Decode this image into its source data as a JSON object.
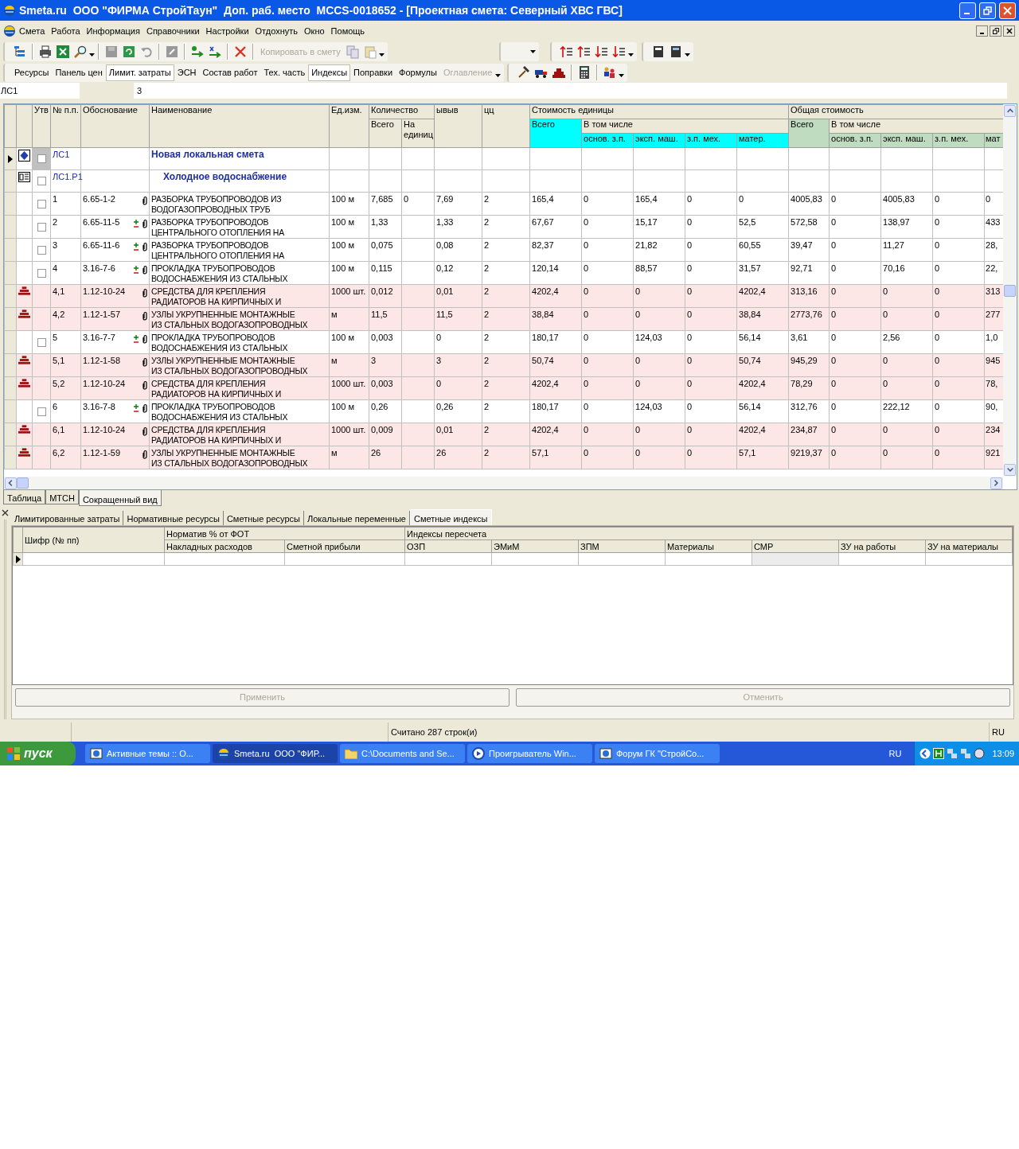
{
  "window": {
    "title": "Smeta.ru  ООО \"ФИРМА СтройТаун\"  Доп. раб. место  MCCS-0018652 - [Проектная смета: Северный ХВС ГВС]"
  },
  "menu": [
    "Смета",
    "Работа",
    "Информация",
    "Справочники",
    "Настройки",
    "Отдохнуть",
    "Окно",
    "Помощь"
  ],
  "copy_button": {
    "label": "Копировать в смету",
    "disabled": true
  },
  "view_buttons": [
    {
      "label": "Ресурсы",
      "pressed": false,
      "disabled": false
    },
    {
      "label": "Панель цен",
      "pressed": false,
      "disabled": false
    },
    {
      "label": "Лимит. затраты",
      "pressed": true,
      "disabled": false
    },
    {
      "label": "ЭСН",
      "pressed": false,
      "disabled": false
    },
    {
      "label": "Состав работ",
      "pressed": false,
      "disabled": false
    },
    {
      "label": "Тех. часть",
      "pressed": false,
      "disabled": false
    },
    {
      "label": "Индексы",
      "pressed": true,
      "disabled": false
    },
    {
      "label": "Поправки",
      "pressed": false,
      "disabled": false
    },
    {
      "label": "Формулы",
      "pressed": false,
      "disabled": false
    },
    {
      "label": "Оглавление",
      "pressed": false,
      "disabled": true
    }
  ],
  "cell_bar": {
    "address": "ЛС1",
    "value": "3"
  },
  "table": {
    "fixed_columns": [
      "Утв",
      "№ п.п.",
      "Обоснование",
      "Наименование",
      "Ед.изм."
    ],
    "quantity": {
      "label": "Количество",
      "sub": [
        "Всего",
        "На единиц"
      ]
    },
    "extra_columns": [
      "ывыв",
      "цц"
    ],
    "cost_groups": [
      {
        "label": "Стоимость единицы",
        "total": "Всего",
        "subgroup": "В том числе",
        "sub": [
          "основ. з.п.",
          "эксп. маш.",
          "з.п. мех.",
          "матер."
        ],
        "color": "#00ffff"
      },
      {
        "label": "Общая стоимость",
        "total": "Всего",
        "subgroup": "В том числе",
        "sub": [
          "основ. з.п.",
          "эксп. маш.",
          "з.п. мех.",
          "мат"
        ],
        "color": "#c0dcc0"
      }
    ],
    "rows": [
      {
        "kind": "estimate",
        "current": true,
        "checked": false,
        "num": "ЛС1",
        "name": "Новая локальная смета"
      },
      {
        "kind": "section",
        "current": false,
        "checked": false,
        "num": "ЛС1.Р1",
        "name": "Холодное водоснабжение"
      },
      {
        "kind": "work",
        "current": false,
        "checked": false,
        "num": "1",
        "code": "6.65-1-2",
        "plus": false,
        "clip": true,
        "name": "РАЗБОРКА ТРУБОПРОВОДОВ ИЗ\nВОДОГАЗОПРОВОДНЫХ ТРУБ",
        "unit": "100 м",
        "qty_total": "7,685",
        "qty_per_unit": "0",
        "col_9": "7,69",
        "col_10": "2",
        "unit_cost": [
          "165,4",
          "0",
          "165,4",
          "0",
          "0"
        ],
        "total_cost": [
          "4005,83",
          "0",
          "4005,83",
          "0",
          "0"
        ]
      },
      {
        "kind": "work",
        "current": false,
        "checked": false,
        "num": "2",
        "code": "6.65-11-5",
        "plus": true,
        "clip": true,
        "name": "РАЗБОРКА ТРУБОПРОВОДОВ\nЦЕНТРАЛЬНОГО ОТОПЛЕНИЯ НА",
        "unit": "100 м",
        "qty_total": "1,33",
        "col_9": "1,33",
        "col_10": "2",
        "unit_cost": [
          "67,67",
          "0",
          "15,17",
          "0",
          "52,5"
        ],
        "total_cost": [
          "572,58",
          "0",
          "138,97",
          "0",
          "433"
        ]
      },
      {
        "kind": "work",
        "current": false,
        "checked": false,
        "num": "3",
        "code": "6.65-11-6",
        "plus": true,
        "clip": true,
        "name": "РАЗБОРКА ТРУБОПРОВОДОВ\nЦЕНТРАЛЬНОГО ОТОПЛЕНИЯ НА",
        "unit": "100 м",
        "qty_total": "0,075",
        "col_9": "0,08",
        "col_10": "2",
        "unit_cost": [
          "82,37",
          "0",
          "21,82",
          "0",
          "60,55"
        ],
        "total_cost": [
          "39,47",
          "0",
          "11,27",
          "0",
          "28,"
        ]
      },
      {
        "kind": "work",
        "current": false,
        "checked": false,
        "num": "4",
        "code": "3.16-7-6",
        "plus": true,
        "clip": true,
        "name": "ПРОКЛАДКА ТРУБОПРОВОДОВ\nВОДОСНАБЖЕНИЯ ИЗ СТАЛЬНЫХ",
        "unit": "100 м",
        "qty_total": "0,115",
        "col_9": "0,12",
        "col_10": "2",
        "unit_cost": [
          "120,14",
          "0",
          "88,57",
          "0",
          "31,57"
        ],
        "total_cost": [
          "92,71",
          "0",
          "70,16",
          "0",
          "22,"
        ]
      },
      {
        "kind": "material",
        "current": false,
        "num": "4,1",
        "code": "1.12-10-24",
        "plus": false,
        "clip": true,
        "name": "СРЕДСТВА ДЛЯ КРЕПЛЕНИЯ\nРАДИАТОРОВ НА КИРПИЧНЫХ И",
        "unit": "1000 шт.",
        "qty_total": "0,012",
        "col_9": "0,01",
        "col_10": "2",
        "unit_cost": [
          "4202,4",
          "0",
          "0",
          "0",
          "4202,4"
        ],
        "total_cost": [
          "313,16",
          "0",
          "0",
          "0",
          "313"
        ]
      },
      {
        "kind": "material",
        "current": false,
        "num": "4,2",
        "code": "1.12-1-57",
        "plus": false,
        "clip": true,
        "name": "УЗЛЫ УКРУПНЕННЫЕ МОНТАЖНЫЕ\nИЗ СТАЛЬНЫХ ВОДОГАЗОПРОВОДНЫХ",
        "unit": "м",
        "qty_total": "11,5",
        "col_9": "11,5",
        "col_10": "2",
        "unit_cost": [
          "38,84",
          "0",
          "0",
          "0",
          "38,84"
        ],
        "total_cost": [
          "2773,76",
          "0",
          "0",
          "0",
          "277"
        ]
      },
      {
        "kind": "work",
        "current": false,
        "checked": false,
        "num": "5",
        "code": "3.16-7-7",
        "plus": true,
        "clip": true,
        "name": "ПРОКЛАДКА ТРУБОПРОВОДОВ\nВОДОСНАБЖЕНИЯ ИЗ СТАЛЬНЫХ",
        "unit": "100 м",
        "qty_total": "0,003",
        "col_9": "0",
        "col_10": "2",
        "unit_cost": [
          "180,17",
          "0",
          "124,03",
          "0",
          "56,14"
        ],
        "total_cost": [
          "3,61",
          "0",
          "2,56",
          "0",
          "1,0"
        ]
      },
      {
        "kind": "material",
        "current": false,
        "num": "5,1",
        "code": "1.12-1-58",
        "plus": false,
        "clip": true,
        "name": "УЗЛЫ УКРУПНЕННЫЕ МОНТАЖНЫЕ\nИЗ СТАЛЬНЫХ ВОДОГАЗОПРОВОДНЫХ",
        "unit": "м",
        "qty_total": "3",
        "col_9": "3",
        "col_10": "2",
        "unit_cost": [
          "50,74",
          "0",
          "0",
          "0",
          "50,74"
        ],
        "total_cost": [
          "945,29",
          "0",
          "0",
          "0",
          "945"
        ]
      },
      {
        "kind": "material",
        "current": false,
        "num": "5,2",
        "code": "1.12-10-24",
        "plus": false,
        "clip": true,
        "name": "СРЕДСТВА ДЛЯ КРЕПЛЕНИЯ\nРАДИАТОРОВ НА КИРПИЧНЫХ И",
        "unit": "1000 шт.",
        "qty_total": "0,003",
        "col_9": "0",
        "col_10": "2",
        "unit_cost": [
          "4202,4",
          "0",
          "0",
          "0",
          "4202,4"
        ],
        "total_cost": [
          "78,29",
          "0",
          "0",
          "0",
          "78,"
        ]
      },
      {
        "kind": "work",
        "current": false,
        "checked": false,
        "num": "6",
        "code": "3.16-7-8",
        "plus": true,
        "clip": true,
        "name": "ПРОКЛАДКА ТРУБОПРОВОДОВ\nВОДОСНАБЖЕНИЯ ИЗ СТАЛЬНЫХ",
        "unit": "100 м",
        "qty_total": "0,26",
        "col_9": "0,26",
        "col_10": "2",
        "unit_cost": [
          "180,17",
          "0",
          "124,03",
          "0",
          "56,14"
        ],
        "total_cost": [
          "312,76",
          "0",
          "222,12",
          "0",
          "90,"
        ]
      },
      {
        "kind": "material",
        "current": false,
        "num": "6,1",
        "code": "1.12-10-24",
        "plus": false,
        "clip": true,
        "name": "СРЕДСТВА ДЛЯ КРЕПЛЕНИЯ\nРАДИАТОРОВ НА КИРПИЧНЫХ И",
        "unit": "1000 шт.",
        "qty_total": "0,009",
        "col_9": "0,01",
        "col_10": "2",
        "unit_cost": [
          "4202,4",
          "0",
          "0",
          "0",
          "4202,4"
        ],
        "total_cost": [
          "234,87",
          "0",
          "0",
          "0",
          "234"
        ]
      },
      {
        "kind": "material",
        "current": false,
        "num": "6,2",
        "code": "1.12-1-59",
        "plus": false,
        "clip": true,
        "name": "УЗЛЫ УКРУПНЕННЫЕ МОНТАЖНЫЕ\nИЗ СТАЛЬНЫХ ВОДОГАЗОПРОВОДНЫХ",
        "unit": "м",
        "qty_total": "26",
        "col_9": "26",
        "col_10": "2",
        "unit_cost": [
          "57,1",
          "0",
          "0",
          "0",
          "57,1"
        ],
        "total_cost": [
          "9219,37",
          "0",
          "0",
          "0",
          "921"
        ]
      }
    ]
  },
  "sheet_tabs": [
    {
      "label": "Таблица",
      "selected": false
    },
    {
      "label": "МТСН",
      "selected": false
    },
    {
      "label": "Сокращенный вид",
      "selected": true
    }
  ],
  "panel_tabs": [
    {
      "label": "Лимитированные затраты",
      "selected": false
    },
    {
      "label": "Нормативные ресурсы",
      "selected": false
    },
    {
      "label": "Сметные ресурсы",
      "selected": false
    },
    {
      "label": "Локальные переменные",
      "selected": false
    },
    {
      "label": "Сметные индексы",
      "selected": true
    }
  ],
  "index_grid": {
    "key_column": "Шифр (№ пп)",
    "groups": [
      {
        "label": "Норматив % от ФОТ",
        "columns": [
          "Накладных расходов",
          "Сметной прибыли"
        ]
      },
      {
        "label": "Индексы пересчета",
        "columns": [
          "ОЗП",
          "ЭМиМ",
          "ЗПМ",
          "Материалы",
          "СМР",
          "ЗУ на работы",
          "ЗУ на материалы"
        ]
      }
    ]
  },
  "panel_buttons": [
    {
      "label": "Применить",
      "disabled": true
    },
    {
      "label": "Отменить",
      "disabled": true
    }
  ],
  "status_bar": {
    "message": "Считано 287 строк(и)",
    "language": "RU"
  },
  "taskbar": {
    "start": "пуск",
    "tasks": [
      {
        "label": "Активные темы :: О...",
        "kind": "browser",
        "selected": false
      },
      {
        "label": "Smeta.ru  ООО \"ФИР...",
        "kind": "app",
        "selected": true
      },
      {
        "label": "C:\\Documents and Se...",
        "kind": "folder",
        "selected": false
      },
      {
        "label": "Проигрыватель Win...",
        "kind": "player",
        "selected": false
      },
      {
        "label": "Форум ГК \"СтройСо...",
        "kind": "browser",
        "selected": false
      }
    ],
    "language": "RU",
    "clock": "13:09"
  }
}
